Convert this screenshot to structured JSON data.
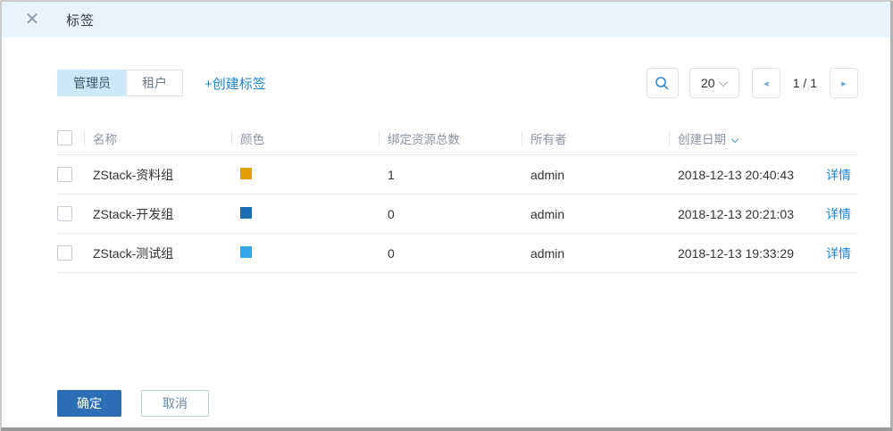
{
  "window": {
    "title": "标签"
  },
  "toolbar": {
    "tabs": [
      {
        "label": "管理员",
        "active": true
      },
      {
        "label": "租户",
        "active": false
      }
    ],
    "create_link": "+创建标签",
    "page_size": "20",
    "page_indicator": "1 / 1",
    "prev_glyph": "◂",
    "next_glyph": "▸"
  },
  "table": {
    "columns": {
      "name": "名称",
      "color": "颜色",
      "bound_count": "绑定资源总数",
      "owner": "所有者",
      "created": "创建日期"
    },
    "rows": [
      {
        "name": "ZStack-资料组",
        "color": "#e2a005",
        "bound_count": "1",
        "owner": "admin",
        "created": "2018-12-13 20:40:43",
        "action": "详情"
      },
      {
        "name": "ZStack-开发组",
        "color": "#1b6cb1",
        "bound_count": "0",
        "owner": "admin",
        "created": "2018-12-13 20:21:03",
        "action": "详情"
      },
      {
        "name": "ZStack-测试组",
        "color": "#35a6e8",
        "bound_count": "0",
        "owner": "admin",
        "created": "2018-12-13 19:33:29",
        "action": "详情"
      }
    ]
  },
  "footer": {
    "confirm_label": "确定",
    "cancel_label": "取消"
  },
  "colors": {
    "accent": "#1f87d2",
    "primary_button": "#2e6eb5",
    "header_bg": "#e8f4fb"
  }
}
